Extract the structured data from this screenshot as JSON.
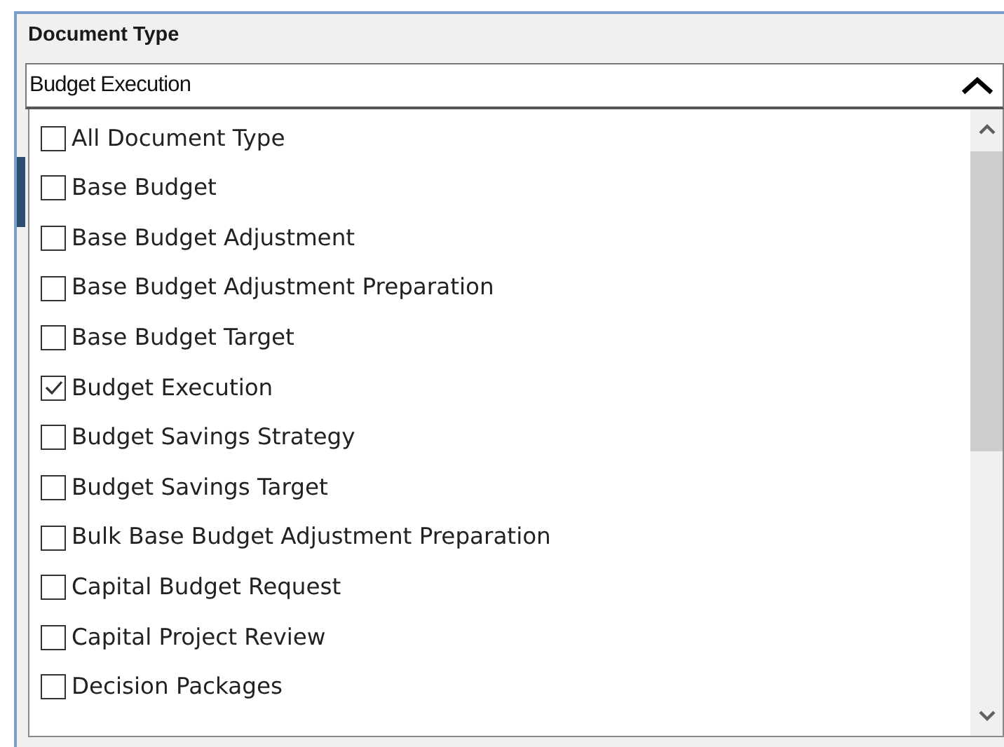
{
  "field": {
    "label": "Document Type",
    "value": "Budget Execution",
    "expanded": true
  },
  "options": [
    {
      "label": "All Document Type",
      "checked": false
    },
    {
      "label": "Base Budget",
      "checked": false
    },
    {
      "label": "Base Budget Adjustment",
      "checked": false
    },
    {
      "label": "Base Budget Adjustment Preparation",
      "checked": false
    },
    {
      "label": "Base Budget Target",
      "checked": false
    },
    {
      "label": "Budget Execution",
      "checked": true
    },
    {
      "label": "Budget Savings Strategy",
      "checked": false
    },
    {
      "label": "Budget Savings Target",
      "checked": false
    },
    {
      "label": "Bulk Base Budget Adjustment Preparation",
      "checked": false
    },
    {
      "label": "Capital Budget Request",
      "checked": false
    },
    {
      "label": "Capital Project Review",
      "checked": false
    },
    {
      "label": "Decision Packages",
      "checked": false
    }
  ]
}
